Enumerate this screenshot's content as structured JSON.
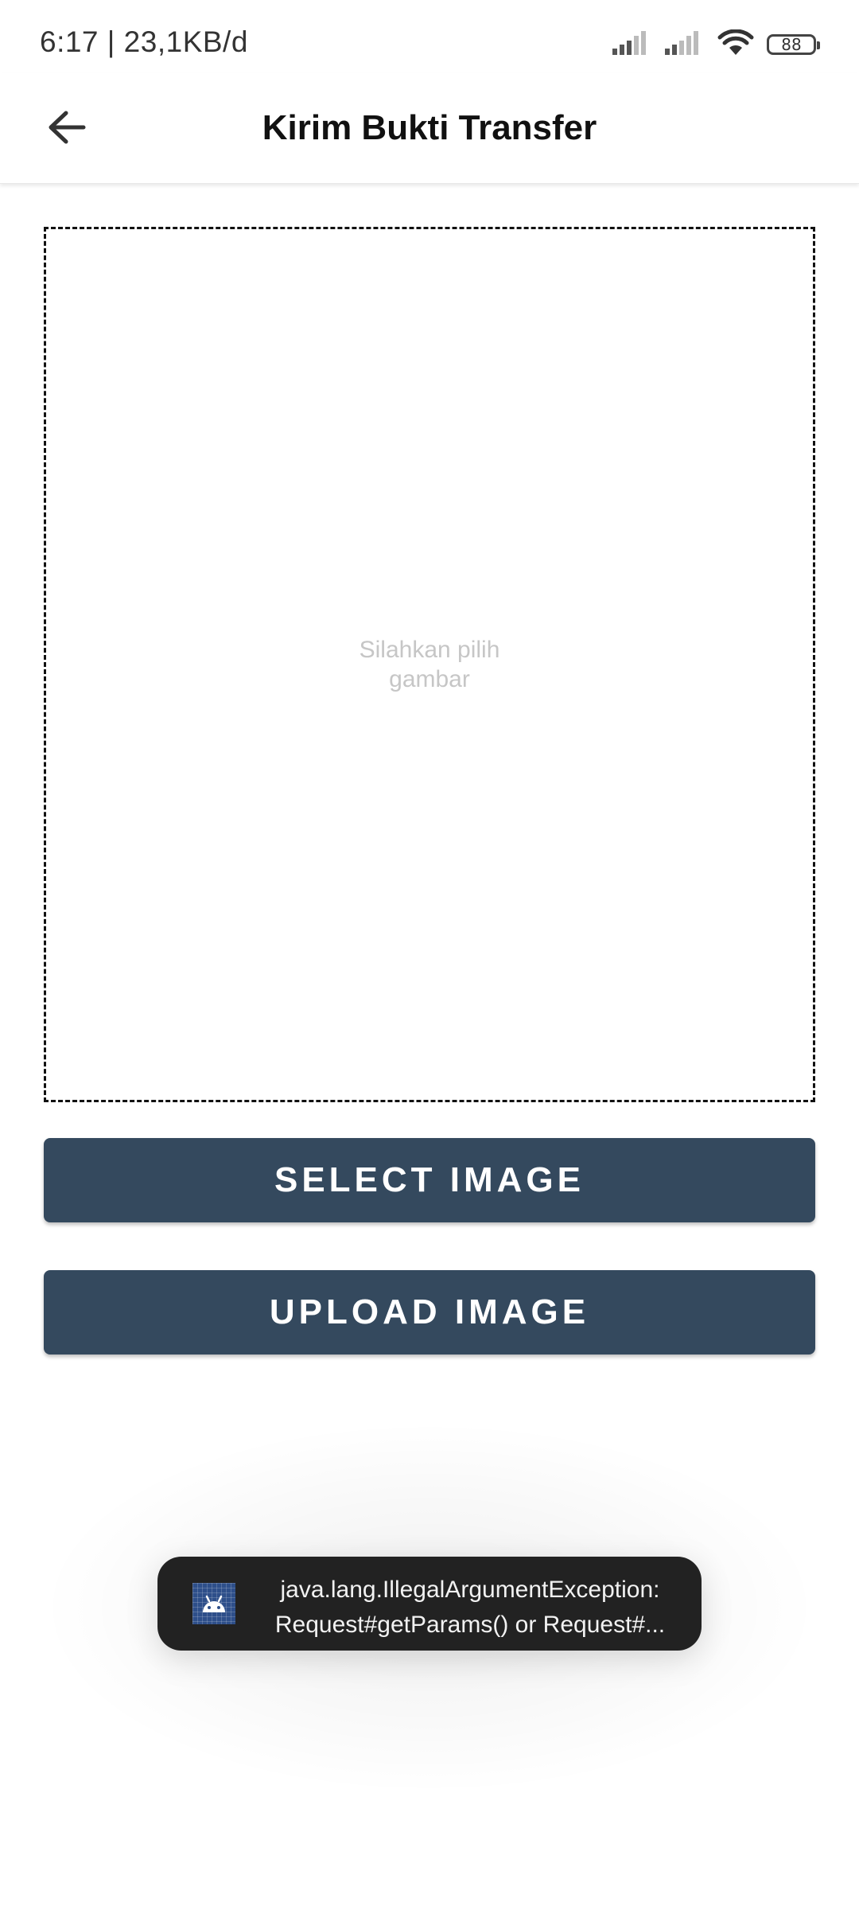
{
  "status_bar": {
    "time_and_speed": "6:17 | 23,1KB/d",
    "battery_level": "88",
    "icons": [
      "signal-1-icon",
      "signal-2-icon",
      "wifi-icon",
      "battery-icon"
    ]
  },
  "app_bar": {
    "title": "Kirim Bukti Transfer",
    "back_icon": "arrow-left-icon"
  },
  "image_picker": {
    "placeholder_line1": "Silahkan pilih",
    "placeholder_line2": "gambar"
  },
  "buttons": {
    "select_label": "SELECT IMAGE",
    "upload_label": "UPLOAD IMAGE"
  },
  "toast": {
    "icon": "android-app-icon",
    "line1": "java.lang.IllegalArgumentException:",
    "line2": "Request#getParams() or Request#..."
  },
  "colors": {
    "button_bg": "#34495e",
    "toast_bg": "#222222",
    "placeholder_text": "#c6c6c6",
    "toast_icon_bg": "#2e4f8a"
  }
}
